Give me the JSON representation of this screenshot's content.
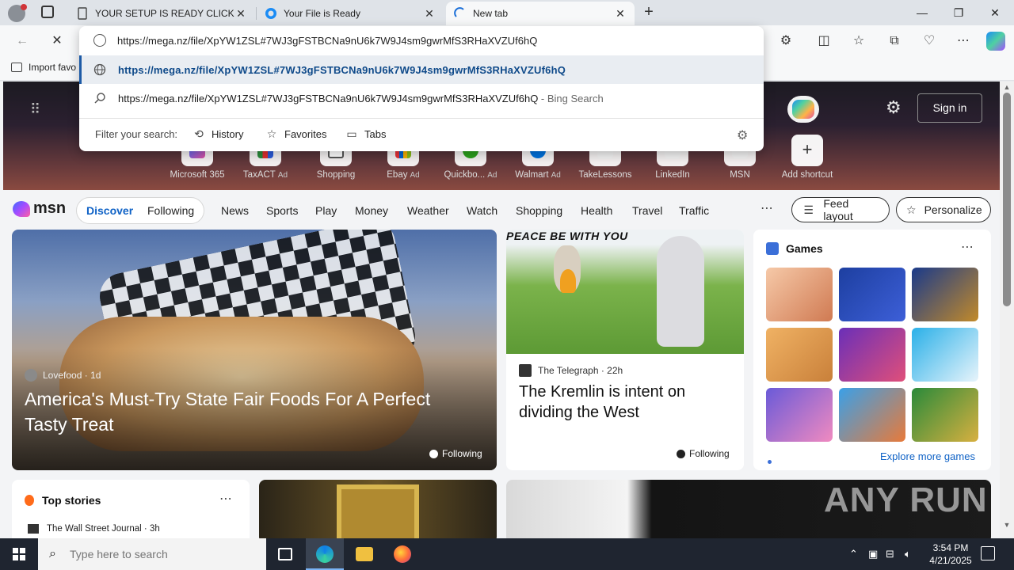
{
  "tabs": [
    {
      "label": "YOUR SETUP IS READY CLICK BELOW",
      "favicon_color": "#555555"
    },
    {
      "label": "Your File is Ready",
      "favicon_color": "#1b8cf5"
    },
    {
      "label": "New tab",
      "favicon_color": "#1b6fd8"
    }
  ],
  "address": {
    "value": "https://mega.nz/file/XpYW1ZSL#7WJ3gFSTBCNa9nU6k7W9J4sm9gwrMfS3RHaXVZUf6hQ",
    "suggestions": [
      {
        "text": "https://mega.nz/file/XpYW1ZSL#7WJ3gFSTBCNa9nU6k7W9J4sm9gwrMfS3RHaXVZUf6hQ",
        "suffix": ""
      },
      {
        "text": "https://mega.nz/file/XpYW1ZSL#7WJ3gFSTBCNa9nU6k7W9J4sm9gwrMfS3RHaXVZUf6hQ",
        "suffix": " - Bing Search"
      }
    ],
    "filter_label": "Filter your search:",
    "filters": [
      "History",
      "Favorites",
      "Tabs"
    ]
  },
  "bookmarks": {
    "import_label": "Import favo"
  },
  "hero": {
    "signin_label": "Sign in",
    "shortcuts": [
      {
        "label": "Microsoft 365",
        "ad": ""
      },
      {
        "label": "TaxACT",
        "ad": "Ad"
      },
      {
        "label": "Shopping",
        "ad": ""
      },
      {
        "label": "Ebay",
        "ad": "Ad"
      },
      {
        "label": "Quickbo...",
        "ad": "Ad"
      },
      {
        "label": "Walmart",
        "ad": "Ad"
      },
      {
        "label": "TakeLessons",
        "ad": ""
      },
      {
        "label": "LinkedIn",
        "ad": ""
      },
      {
        "label": "MSN",
        "ad": ""
      },
      {
        "label": "Add shortcut",
        "ad": ""
      }
    ]
  },
  "msn": {
    "logo": "msn",
    "discover": "Discover",
    "following": "Following",
    "links": [
      "News",
      "Sports",
      "Play",
      "Money",
      "Weather",
      "Watch",
      "Shopping",
      "Health",
      "Travel",
      "Traffic"
    ],
    "feed_layout": "Feed layout",
    "personalize": "Personalize"
  },
  "cards": {
    "big": {
      "source": "Lovefood",
      "age": "1d",
      "title": "America's Must-Try State Fair Foods For A Perfect Tasty Treat",
      "follow": "Following"
    },
    "mid": {
      "caption": "PEACE BE WITH YOU",
      "source": "The Telegraph",
      "age": "22h",
      "title": "The Kremlin is intent on dividing the West",
      "follow": "Following"
    },
    "games": {
      "title": "Games",
      "explore": "Explore more games"
    },
    "top_stories": {
      "title": "Top stories",
      "source": "The Wall Street Journal",
      "age": "3h"
    }
  },
  "watermark": "ANY RUN",
  "taskbar": {
    "search_placeholder": "Type here to search",
    "time": "3:54 PM",
    "date": "4/21/2025"
  }
}
